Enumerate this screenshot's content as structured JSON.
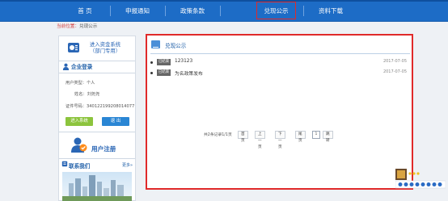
{
  "nav": {
    "items": [
      {
        "label": "首 页"
      },
      {
        "label": "申报通知"
      },
      {
        "label": "政策条款"
      },
      {
        "label": "兑现公示"
      },
      {
        "label": "资料下载"
      }
    ]
  },
  "breadcrumb": {
    "prefix": "当前位置：",
    "current": "兑现公示"
  },
  "sidebar": {
    "system_title_line1": "进入资金系统",
    "system_title_line2": "（部门专用）",
    "login_title": "企业登录",
    "user_type_label": "用户类型：",
    "user_type_value": "个人",
    "name_label": "姓名：",
    "name_value": "刘尧尧",
    "id_label": "证件号码：",
    "id_value": "340122199208014077",
    "enter_button": "进入系统",
    "exit_button": "退 出",
    "register_title": "用户注册",
    "contact_title": "联系我们",
    "more": "更多»"
  },
  "main": {
    "title": "兑现公示",
    "items": [
      {
        "tag": "已结束",
        "title": "123123",
        "date": "2017-07-05"
      },
      {
        "tag": "已结束",
        "title": "为名政策发布",
        "date": "2017-07-05"
      }
    ],
    "pager": {
      "summary": "共2条记录1/1页",
      "first": "首页",
      "prev": "上一页",
      "next": "下一页",
      "last": "尾页",
      "page_value": "1",
      "go": "跳转"
    }
  },
  "colors": {
    "nav_bg": "#1d6cc6",
    "highlight": "#e02a2a",
    "green_btn": "#8cc43d",
    "blue_btn": "#2a86d4"
  }
}
